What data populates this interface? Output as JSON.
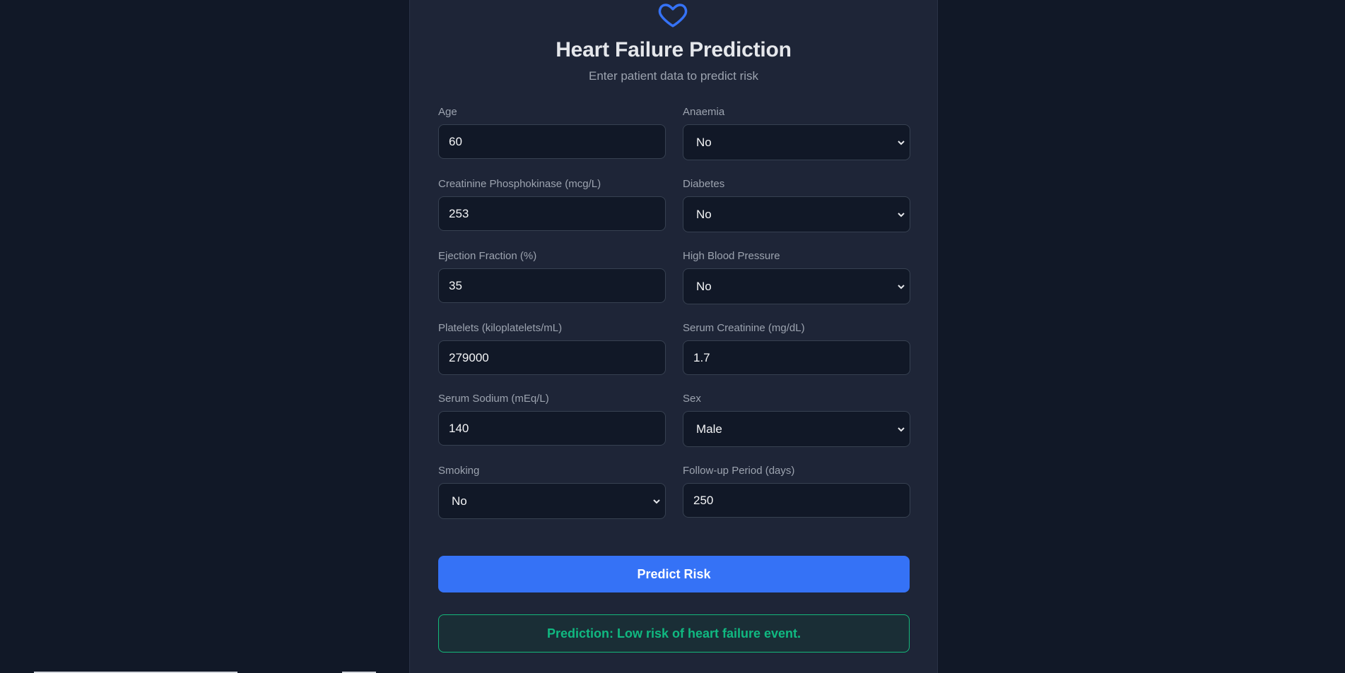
{
  "header": {
    "icon": "heart-icon",
    "title": "Heart Failure Prediction",
    "subtitle": "Enter patient data to predict risk"
  },
  "form": {
    "age": {
      "label": "Age",
      "value": "60"
    },
    "anaemia": {
      "label": "Anaemia",
      "value": "No"
    },
    "cpk": {
      "label": "Creatinine Phosphokinase (mcg/L)",
      "value": "253"
    },
    "diabetes": {
      "label": "Diabetes",
      "value": "No"
    },
    "ejection_fraction": {
      "label": "Ejection Fraction (%)",
      "value": "35"
    },
    "high_blood_pressure": {
      "label": "High Blood Pressure",
      "value": "No"
    },
    "platelets": {
      "label": "Platelets (kiloplatelets/mL)",
      "value": "279000"
    },
    "serum_creatinine": {
      "label": "Serum Creatinine (mg/dL)",
      "value": "1.7"
    },
    "serum_sodium": {
      "label": "Serum Sodium (mEq/L)",
      "value": "140"
    },
    "sex": {
      "label": "Sex",
      "value": "Male"
    },
    "smoking": {
      "label": "Smoking",
      "value": "No"
    },
    "follow_up": {
      "label": "Follow-up Period (days)",
      "value": "250"
    }
  },
  "actions": {
    "predict_label": "Predict Risk"
  },
  "result": {
    "text": "Prediction: Low risk of heart failure event."
  },
  "colors": {
    "background": "#111827",
    "card": "#1e2537",
    "accent": "#3572f6",
    "success": "#10b981"
  }
}
